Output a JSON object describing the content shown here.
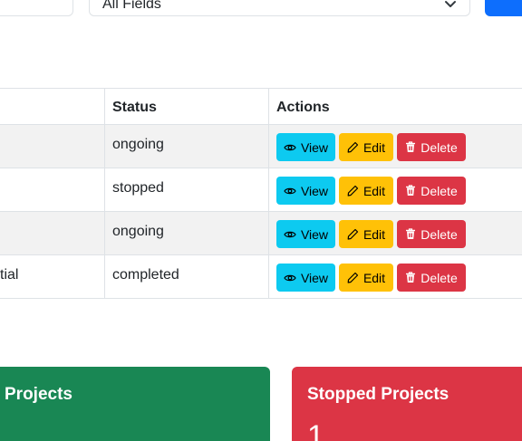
{
  "filter": {
    "field_select_value": "All Fields"
  },
  "table": {
    "headers": {
      "status": "Status",
      "actions": "Actions"
    },
    "rows": [
      {
        "name": "",
        "status": "ongoing"
      },
      {
        "name": "",
        "status": "stopped"
      },
      {
        "name": "",
        "status": "ongoing"
      },
      {
        "name": "tial",
        "status": "completed"
      }
    ],
    "actions": {
      "view": "View",
      "edit": "Edit",
      "delete": "Delete"
    }
  },
  "cards": {
    "completed": {
      "title": "Projects"
    },
    "stopped": {
      "title": "Stopped Projects",
      "count": "1"
    }
  },
  "colors": {
    "view": "#0dcaf0",
    "edit": "#ffc107",
    "delete": "#dc3545",
    "card_green": "#198754",
    "card_red": "#dc3545",
    "primary": "#0d6efd"
  }
}
